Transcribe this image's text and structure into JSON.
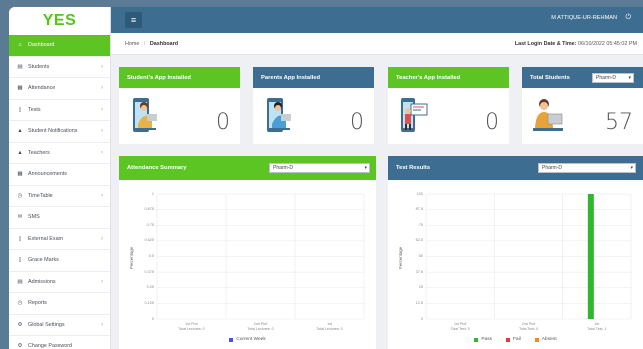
{
  "app": {
    "logo": "YES"
  },
  "sidebar": {
    "items": [
      {
        "label": "Dashboard",
        "icon": "home-icon",
        "glyph": "⌂",
        "active": true,
        "chevron": false
      },
      {
        "label": "Students",
        "icon": "students-icon",
        "glyph": "▤",
        "active": false,
        "chevron": true
      },
      {
        "label": "Attendance",
        "icon": "calendar-icon",
        "glyph": "▦",
        "active": false,
        "chevron": true
      },
      {
        "label": "Tests",
        "icon": "document-icon",
        "glyph": "▯",
        "active": false,
        "chevron": true
      },
      {
        "label": "Student Notifications",
        "icon": "bell-icon",
        "glyph": "▲",
        "active": false,
        "chevron": true
      },
      {
        "label": "Teachers",
        "icon": "teacher-icon",
        "glyph": "▲",
        "active": false,
        "chevron": true
      },
      {
        "label": "Announcements",
        "icon": "announcement-icon",
        "glyph": "▦",
        "active": false,
        "chevron": false
      },
      {
        "label": "TimeTable",
        "icon": "clock-icon",
        "glyph": "◷",
        "active": false,
        "chevron": true
      },
      {
        "label": "SMS",
        "icon": "envelope-icon",
        "glyph": "✉",
        "active": false,
        "chevron": false
      },
      {
        "label": "External Exam",
        "icon": "exam-icon",
        "glyph": "▯",
        "active": false,
        "chevron": true
      },
      {
        "label": "Grace Marks",
        "icon": "grace-marks-icon",
        "glyph": "▯",
        "active": false,
        "chevron": false
      },
      {
        "label": "Admissions",
        "icon": "admissions-icon",
        "glyph": "▤",
        "active": false,
        "chevron": true
      },
      {
        "label": "Reports",
        "icon": "reports-icon",
        "glyph": "◷",
        "active": false,
        "chevron": false
      },
      {
        "label": "Global Settings",
        "icon": "gear-icon",
        "glyph": "⚙",
        "active": false,
        "chevron": true
      },
      {
        "label": "Change Password",
        "icon": "key-icon",
        "glyph": "⚙",
        "active": false,
        "chevron": false
      }
    ]
  },
  "topbar": {
    "menu_glyph": "≡",
    "user": "M ATTIQUE-UR-REHMAN",
    "power_glyph": "⏻"
  },
  "breadcrumb": {
    "home": "Home",
    "sep": "/",
    "current": "Dashboard"
  },
  "last_login": {
    "label": "Last Login Date & Time:",
    "value": "06/10/2022 05:45:02 PM"
  },
  "cards": {
    "students_app": {
      "title": "Student's App Installed",
      "value": "0"
    },
    "parents_app": {
      "title": "Parents App Installed",
      "value": "0"
    },
    "teachers_app": {
      "title": "Teacher's App Installed",
      "value": "0"
    },
    "total_students": {
      "title": "Total Students",
      "value": "57",
      "select": "Pharm-D"
    }
  },
  "attendance": {
    "title": "Attendance Summary",
    "select": "Pharm-D",
    "ylabel": "Percentage",
    "legend": [
      {
        "label": "Current Week",
        "color": "#4e4ef0"
      }
    ]
  },
  "tests": {
    "title": "Test Results",
    "select": "Pharm-D",
    "ylabel": "Percentage",
    "legend": [
      {
        "label": "Pass",
        "color": "#2eb82e"
      },
      {
        "label": "Fail",
        "color": "#e03a3a"
      },
      {
        "label": "Absent",
        "color": "#f08a24"
      }
    ]
  },
  "chart_data": [
    {
      "type": "bar",
      "title": "Attendance Summary",
      "ylabel": "Percentage",
      "ylim": [
        0,
        1
      ],
      "yticks": [
        "1",
        "0.875",
        "0.75",
        "0.625",
        "0.5",
        "0.375",
        "0.25",
        "0.125",
        "0"
      ],
      "categories": [
        "1st Prof\nTotal Lectures: 0",
        "2nd Prof\nTotal Lectures: 0",
        "1st\nTotal Lectures: 0"
      ],
      "series": [
        {
          "name": "Current Week",
          "color": "#4e4ef0",
          "values": [
            0,
            0,
            0
          ]
        }
      ]
    },
    {
      "type": "bar",
      "title": "Test Results",
      "ylabel": "Percentage",
      "ylim": [
        0,
        100
      ],
      "yticks": [
        "100",
        "87.5",
        "75",
        "62.5",
        "50",
        "37.5",
        "25",
        "12.5",
        "0"
      ],
      "categories": [
        "1st Prof\nTotal Test: 0",
        "2nd Prof\nTotal Test: 0",
        "1st\nTotal Test: 1"
      ],
      "series": [
        {
          "name": "Pass",
          "color": "#2eb82e",
          "values": [
            0,
            0,
            100
          ]
        },
        {
          "name": "Fail",
          "color": "#e03a3a",
          "values": [
            0,
            0,
            0
          ]
        },
        {
          "name": "Absent",
          "color": "#f08a24",
          "values": [
            0,
            0,
            0
          ]
        }
      ]
    }
  ]
}
